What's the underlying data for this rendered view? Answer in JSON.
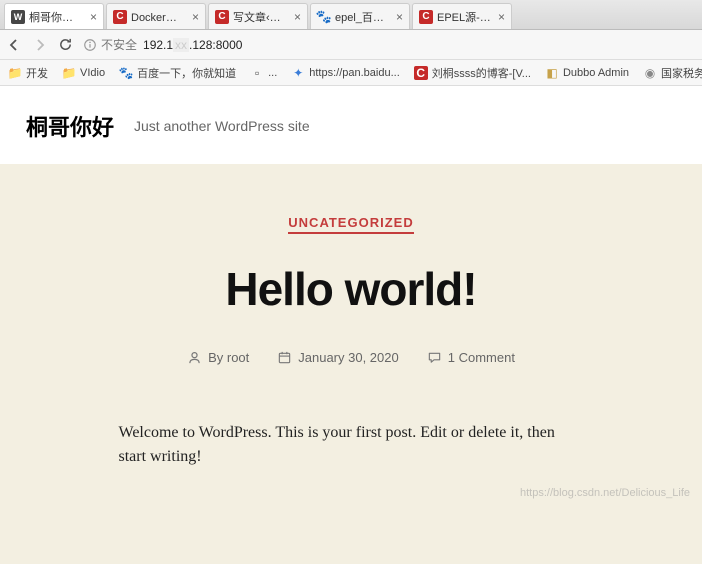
{
  "browser": {
    "tabs": [
      {
        "label": "桐哥你好 – Ju",
        "icon": "wp",
        "active": true
      },
      {
        "label": "Docker常用命",
        "icon": "c"
      },
      {
        "label": "写文章‹CSDN",
        "icon": "c"
      },
      {
        "label": "epel_百度搜索",
        "icon": "baidu"
      },
      {
        "label": "EPEL源-是什",
        "icon": "c"
      },
      {
        "label": "...",
        "icon": ""
      }
    ],
    "toolbar": {
      "insecure_label": "不安全",
      "url_pre": "192.1",
      "url_mid": "xx",
      "url_post": ".128:8000"
    },
    "bookmarks": [
      {
        "label": "开发",
        "icon": "folder"
      },
      {
        "label": "VIdio",
        "icon": "folder"
      },
      {
        "label": "百度一下，你就知道",
        "icon": "baidu"
      },
      {
        "label": "...",
        "icon": ""
      },
      {
        "label": "...",
        "icon": ""
      },
      {
        "label": "https://pan.baidu...",
        "icon": "link"
      },
      {
        "label": "刘桐ssss的博客-[V...",
        "icon": "c"
      },
      {
        "label": "Dubbo Admin",
        "icon": "box"
      },
      {
        "label": "国家税务总局河北...",
        "icon": "globe"
      }
    ]
  },
  "page": {
    "site_title": "桐哥你好",
    "tagline": "Just another WordPress site",
    "post": {
      "category": "UNCATEGORIZED",
      "title": "Hello world!",
      "author_prefix": "By ",
      "author": "root",
      "date": "January 30, 2020",
      "comments": "1 Comment",
      "content": "Welcome to WordPress. This is your first post. Edit or delete it, then start writing!"
    }
  },
  "watermark": "https://blog.csdn.net/Delicious_Life"
}
